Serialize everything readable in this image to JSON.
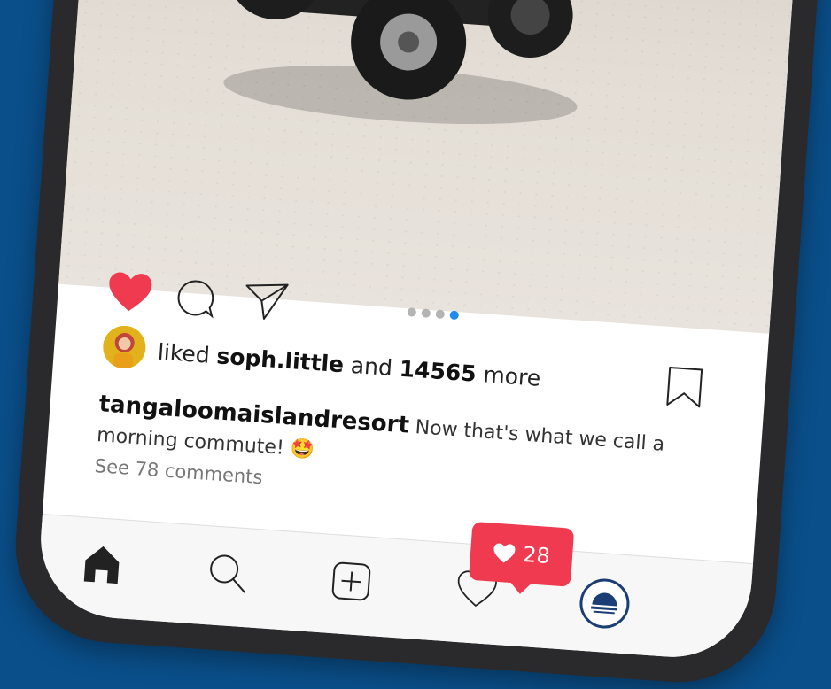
{
  "post": {
    "liker_name": "soph.little",
    "like_prefix": "liked",
    "like_joiner": "and",
    "like_count": "14565",
    "like_suffix": "more",
    "author": "tangaloomaislandresort",
    "caption": "Now that's what we call a morning commute!",
    "caption_emoji": "🤩",
    "comments_link": "See 78 comments",
    "carousel": {
      "total": 4,
      "active_index": 3
    }
  },
  "notification": {
    "icon": "heart-icon",
    "count": "28"
  },
  "nav": {
    "items": [
      "home-icon",
      "search-icon",
      "add-post-icon",
      "activity-heart-icon",
      "profile-avatar"
    ]
  },
  "colors": {
    "background": "#0a4f8a",
    "like_red": "#f03a4f",
    "carousel_active": "#1c8cf2"
  }
}
